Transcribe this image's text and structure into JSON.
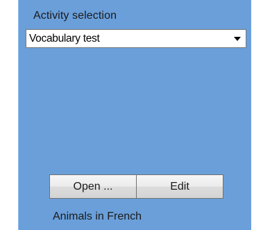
{
  "activity": {
    "label": "Activity selection",
    "selected": "Vocabulary test",
    "arrow_icon": "chevron-down-icon"
  },
  "actions": {
    "open_label": "Open ...",
    "edit_label": "Edit"
  },
  "footer": {
    "text": "Animals in French"
  },
  "colors": {
    "panel_bg": "#6a9fda"
  }
}
